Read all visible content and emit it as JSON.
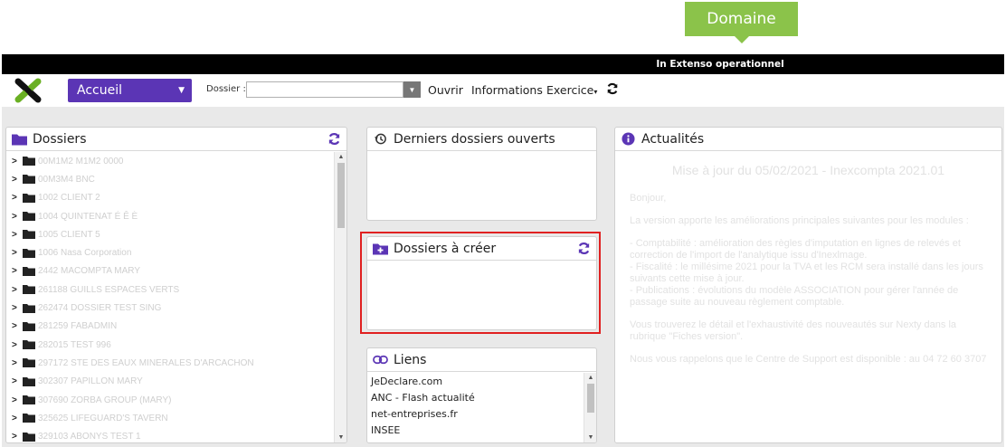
{
  "tooltip": {
    "label": "Domaine",
    "color": "#8bc34a"
  },
  "topbar": {
    "title": "In Extenso operationnel"
  },
  "toolbar": {
    "home_label": "Accueil",
    "dossier_label": "Dossier :",
    "dossier_value": "",
    "menu": [
      "Ouvrir",
      "Informations",
      "Exercice"
    ],
    "accent": "#5b35b5"
  },
  "dossiers": {
    "title": "Dossiers",
    "items": [
      "00M1M2 M1M2 0000",
      "00M3M4 BNC",
      "1002 CLIENT 2",
      "1004 QUINTENAT É Ê È",
      "1005 CLIENT 5",
      "1006 Nasa Corporation",
      "2442 MACOMPTA MARY",
      "261188 GUILLS ESPACES VERTS",
      "262474 DOSSIER TEST SING",
      "281259 FABADMIN",
      "282015 TEST 996",
      "297172 STE DES EAUX MINERALES D'ARCACHON",
      "302307 PAPILLON MARY",
      "307690 ZORBA GROUP (MARY)",
      "325625 LIFEGUARD'S TAVERN",
      "329103 ABONYS TEST 1"
    ]
  },
  "derniers": {
    "title": "Derniers dossiers ouverts"
  },
  "acreer": {
    "title": "Dossiers à créer"
  },
  "liens": {
    "title": "Liens",
    "items": [
      "JeDeclare.com",
      "ANC - Flash actualité",
      "net-entreprises.fr",
      "INSEE"
    ]
  },
  "actualites": {
    "title": "Actualités",
    "news_title": "Mise à jour du 05/02/2021 - Inexcompta 2021.01",
    "p1": "Bonjour,",
    "p2": "La version apporte les améliorations principales suivantes pour les modules :",
    "b1": "- Comptabilité : amélioration des règles d'imputation en lignes de relevés et correction de l'import de l'analytique issu d'Inexlmage.",
    "b2": "- Fiscalité : le millésime 2021 pour la TVA et les RCM sera installé dans les jours suivants cette mise à jour.",
    "b3": "- Publications : évolutions du modèle ASSOCIATION pour gérer l'année de passage suite au nouveau règlement comptable.",
    "p3": "Vous trouverez le détail et l'exhaustivité des nouveautés sur Nexty dans la rubrique \"Fiches version\".",
    "p4": "Nous vous rappelons que le Centre de Support est disponible : au 04 72 60 3707"
  }
}
